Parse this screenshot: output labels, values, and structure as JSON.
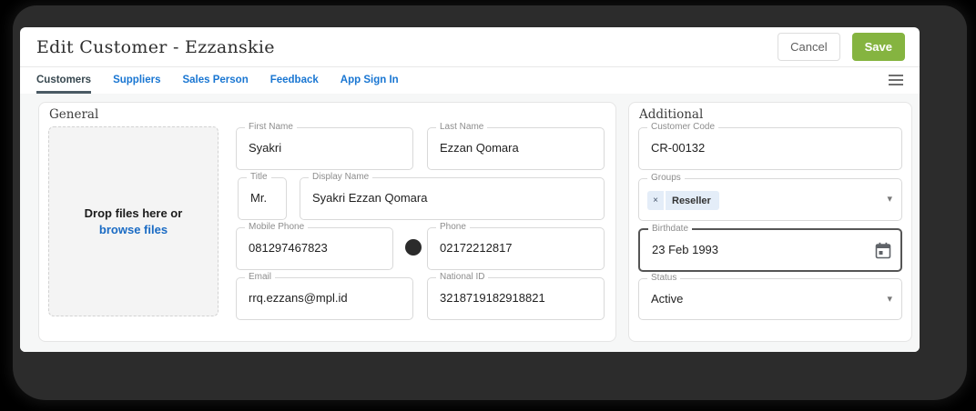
{
  "window": {
    "title": "Edit Customer - Ezzanskie",
    "cancel_label": "Cancel",
    "save_label": "Save"
  },
  "tabs": [
    {
      "label": "Customers",
      "active": true
    },
    {
      "label": "Suppliers",
      "active": false
    },
    {
      "label": "Sales Person",
      "active": false
    },
    {
      "label": "Feedback",
      "active": false
    },
    {
      "label": "App Sign In",
      "active": false
    }
  ],
  "general": {
    "title": "General",
    "dropzone": {
      "line1": "Drop files here or",
      "link": "browse files"
    },
    "first_name": {
      "label": "First Name",
      "value": "Syakri"
    },
    "last_name": {
      "label": "Last Name",
      "value": "Ezzan Qomara"
    },
    "title_field": {
      "label": "Title",
      "value": "Mr."
    },
    "display_name": {
      "label": "Display Name",
      "value": "Syakri Ezzan Qomara"
    },
    "mobile_phone": {
      "label": "Mobile Phone",
      "value": "081297467823"
    },
    "phone": {
      "label": "Phone",
      "value": "02172212817"
    },
    "email": {
      "label": "Email",
      "value": "rrq.ezzans@mpl.id"
    },
    "national_id": {
      "label": "National ID",
      "value": "3218719182918821"
    }
  },
  "additional": {
    "title": "Additional",
    "customer_code": {
      "label": "Customer Code",
      "value": "CR-00132"
    },
    "groups": {
      "label": "Groups",
      "chip_label": "Reseller",
      "chip_remove": "×"
    },
    "birthdate": {
      "label": "Birthdate",
      "value": "23 Feb 1993"
    },
    "status": {
      "label": "Status",
      "value": "Active"
    }
  },
  "icons": {
    "caret": "▾"
  },
  "colors": {
    "save_green": "#85b440",
    "tab_blue": "#1976d2",
    "active_tab": "#37474f",
    "link_blue": "#1a6bc4",
    "chip_bg": "#e4edf8"
  }
}
